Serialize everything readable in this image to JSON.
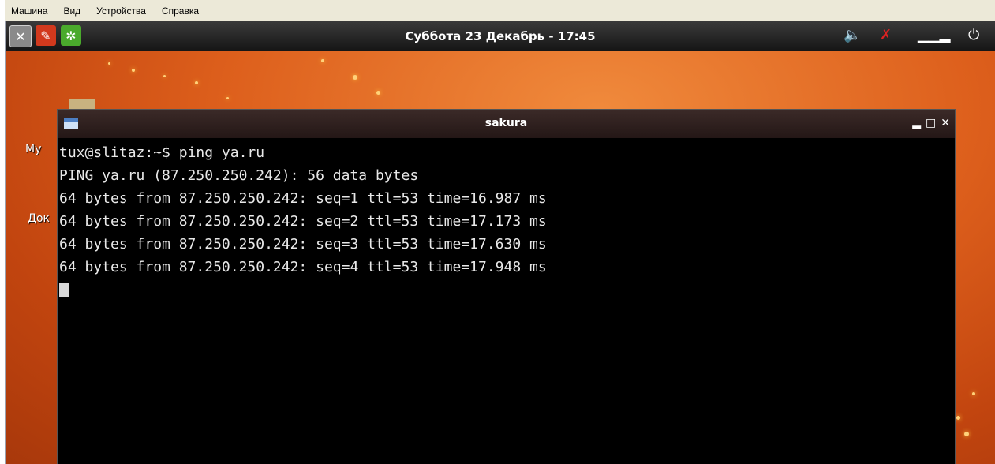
{
  "host_menu": {
    "items": [
      "Машина",
      "Вид",
      "Устройства",
      "Справка"
    ]
  },
  "panel": {
    "clock": "Суббота 23 Декабрь - 17:45",
    "left_icons": [
      "x-icon",
      "tools-icon",
      "gear-icon"
    ],
    "tray_icons": [
      "volume-icon",
      "network-disconnected-icon",
      "cpu-monitor-icon",
      "power-icon"
    ]
  },
  "desktop": {
    "labels": [
      "My",
      "Док"
    ]
  },
  "terminal": {
    "title": "sakura",
    "controls": {
      "minimize": "▂",
      "maximize": "□",
      "close": "✕"
    },
    "lines": [
      "tux@slitaz:~$ ping ya.ru",
      "PING ya.ru (87.250.250.242): 56 data bytes",
      "64 bytes from 87.250.250.242: seq=1 ttl=53 time=16.987 ms",
      "64 bytes from 87.250.250.242: seq=2 ttl=53 time=17.173 ms",
      "64 bytes from 87.250.250.242: seq=3 ttl=53 time=17.630 ms",
      "64 bytes from 87.250.250.242: seq=4 ttl=53 time=17.948 ms"
    ]
  },
  "colors": {
    "panel": "#1f1f1f",
    "wallpaper": "#dd5f1c",
    "terminal_bg": "#000000",
    "terminal_fg": "#e8e8e8"
  }
}
